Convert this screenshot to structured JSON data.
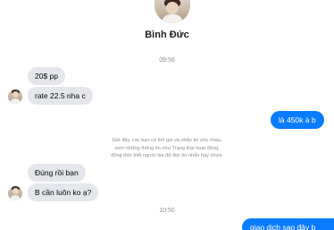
{
  "header": {
    "contact_name": "Bình Đức"
  },
  "timestamps": {
    "first": "09:56",
    "second": "10:50"
  },
  "messages": [
    {
      "direction": "incoming",
      "text": "20$ pp"
    },
    {
      "direction": "incoming",
      "text": "rate 22.5 nha c"
    },
    {
      "direction": "outgoing",
      "text": "là 450k à b"
    },
    {
      "direction": "incoming",
      "text": "Đúng rồi bạn"
    },
    {
      "direction": "incoming",
      "text": "B cần luôn ko ạ?"
    },
    {
      "direction": "outgoing",
      "text": "giao dịch sao đây b"
    }
  ],
  "system_notice": {
    "line1": "Giờ đây, các bạn có thể gọi và nhắn tin cho nhau,",
    "line2": "xem những thông tin như Trạng thái hoạt động,",
    "line3": "đồng thời biết người kia đã đọc tin nhắn hay chưa."
  },
  "colors": {
    "outgoing_bubble": "#0a7cff",
    "incoming_bubble": "#e4e6eb",
    "muted_text": "#8a8d91"
  }
}
